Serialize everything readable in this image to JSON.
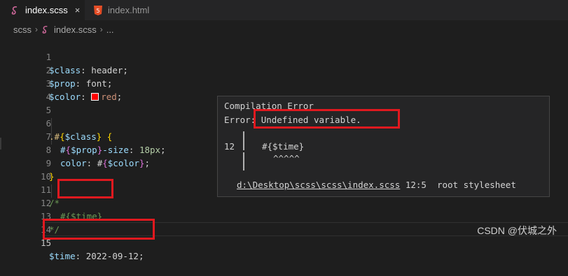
{
  "tabs": [
    {
      "label": "index.scss",
      "icon": "sass-icon",
      "active": true,
      "close": "×"
    },
    {
      "label": "index.html",
      "icon": "html5-icon",
      "active": false
    }
  ],
  "breadcrumb": {
    "items": [
      "scss",
      "index.scss",
      "..."
    ],
    "separator": "›"
  },
  "code": {
    "line_numbers": [
      "1",
      "2",
      "3",
      "4",
      "5",
      "6",
      "7",
      "8",
      "9",
      "10",
      "11",
      "12",
      "13",
      "14",
      "15"
    ],
    "l1": {
      "var": "$class",
      "colon": ":",
      "value": " header",
      "end": ";"
    },
    "l2": {
      "var": "$prop",
      "colon": ":",
      "value": " font",
      "end": ";"
    },
    "l3": {
      "var": "$color",
      "colon": ":",
      "value": "red",
      "end": ";"
    },
    "l6": {
      "dot": ".",
      "hash": "#",
      "open": "{",
      "var": "$class",
      "close": "}",
      "brace": " {"
    },
    "l7": {
      "hash": "#",
      "open": "{",
      "var": "$prop",
      "close": "}",
      "rest": "-size",
      "colon": ": ",
      "num": "18px",
      "end": ";"
    },
    "l8": {
      "prop": "color",
      "colon": ": ",
      "hash": "#",
      "open": "{",
      "var": "$color",
      "close": "}",
      "end": ";"
    },
    "l9": {
      "close": "}"
    },
    "l11": {
      "text": "/*"
    },
    "l12": {
      "text": "#{$time}"
    },
    "l13": {
      "text": "*/"
    },
    "l15": {
      "var": "$time",
      "colon": ":",
      "value": " 2022-09-12",
      "end": ";"
    }
  },
  "error_popup": {
    "title": "Compilation Error",
    "error_prefix": "Error: ",
    "message": "Undefined variable.",
    "line_no": "12",
    "code_line": "#{$time}",
    "carets": "^^^^^",
    "file": "d:\\Desktop\\scss\\scss\\index.scss",
    "position": " 12:5  root stylesheet"
  },
  "colors": {
    "swatch": "#ff0000",
    "highlight_box": "#e0191f"
  },
  "watermark": "CSDN @伏城之外"
}
